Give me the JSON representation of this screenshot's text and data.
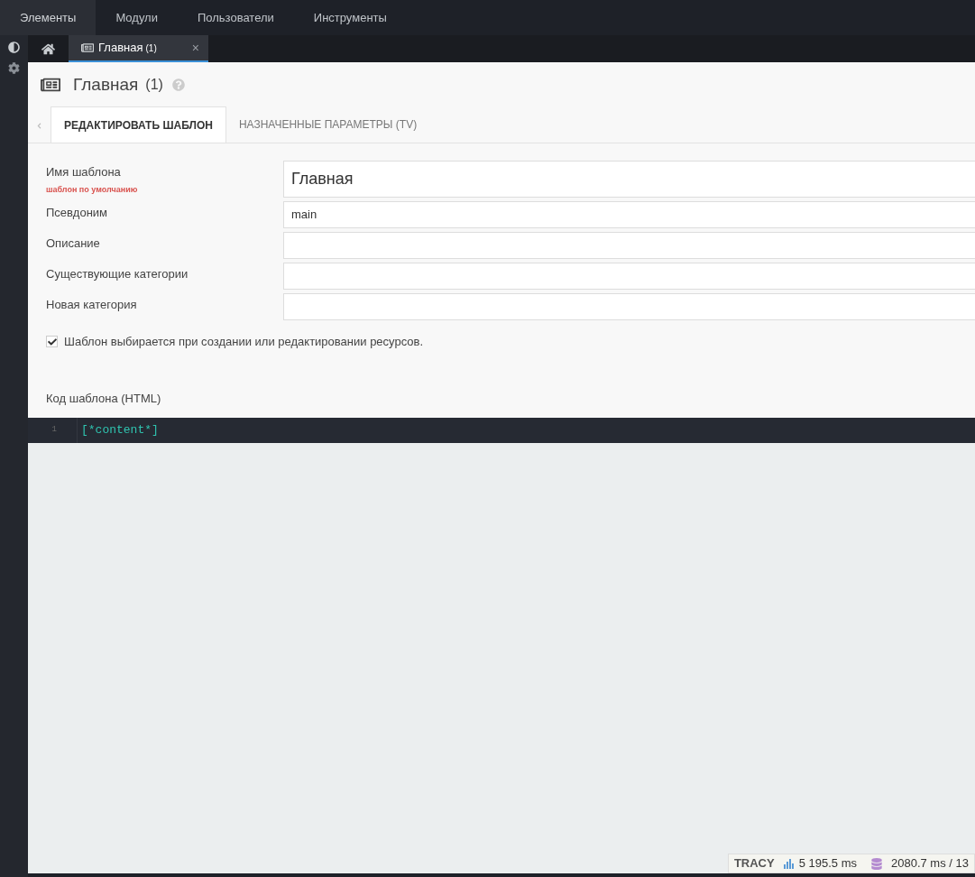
{
  "top_menu": [
    {
      "label": "Элементы",
      "selected": true
    },
    {
      "label": "Модули",
      "selected": false
    },
    {
      "label": "Пользователи",
      "selected": false
    },
    {
      "label": "Инструменты",
      "selected": false
    }
  ],
  "doc_tabs": [
    {
      "kind": "home",
      "selected": false
    },
    {
      "kind": "doc",
      "label": "Главная",
      "count": "(1)",
      "selected": true,
      "close": "×"
    }
  ],
  "page": {
    "title": "Главная",
    "count": "(1)"
  },
  "content_tabs": [
    {
      "label": "РЕДАКТИРОВАТЬ ШАБЛОН",
      "selected": true
    },
    {
      "label": "НАЗНАЧЕННЫЕ ПАРАМЕТРЫ (TV)",
      "selected": false
    }
  ],
  "fields": [
    {
      "label": "Имя шаблона",
      "note": "шаблон по умолчанию",
      "value": "Главная",
      "kind": "large"
    },
    {
      "label": "Псевдоним",
      "value": "main",
      "kind": "normal"
    },
    {
      "label": "Описание",
      "kind": "normal"
    },
    {
      "label": "Существующие категории",
      "kind": "normal"
    },
    {
      "label": "Новая категория",
      "kind": "normal"
    }
  ],
  "selectable_checkbox": {
    "label": "Шаблон выбирается при создании или редактировании ресурсов.",
    "checked": true
  },
  "code": {
    "label": "Код шаблона (HTML)",
    "lines": [
      {
        "number": "1",
        "text": "[*content*]"
      }
    ]
  },
  "tracy": {
    "title": "TRACY",
    "time": "5 195.5 ms",
    "db": "2080.7 ms / 13"
  }
}
